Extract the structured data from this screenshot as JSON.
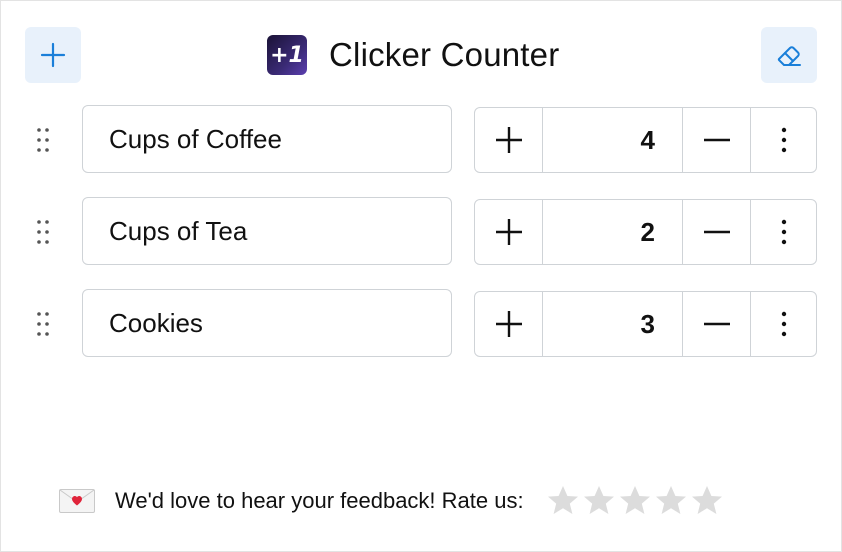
{
  "header": {
    "title": "Clicker Counter",
    "logo_text": "+1",
    "add_icon": "plus-icon",
    "clear_icon": "eraser-icon",
    "accent_color": "#1a7fd9",
    "button_bg": "#e8f1fb"
  },
  "counters": [
    {
      "name": "Cups of Coffee",
      "value": "4"
    },
    {
      "name": "Cups of Tea",
      "value": "2"
    },
    {
      "name": "Cookies",
      "value": "3"
    }
  ],
  "row_icons": {
    "drag": "drag-handle-icon",
    "increment": "plus-icon",
    "decrement": "minus-icon",
    "more": "more-vertical-icon"
  },
  "footer": {
    "mail_icon": "love-letter-icon",
    "feedback_text": "We'd love to hear your feedback! Rate us:",
    "rating": {
      "value": 0,
      "max": 5
    },
    "star_color": "#dcdcdc"
  }
}
